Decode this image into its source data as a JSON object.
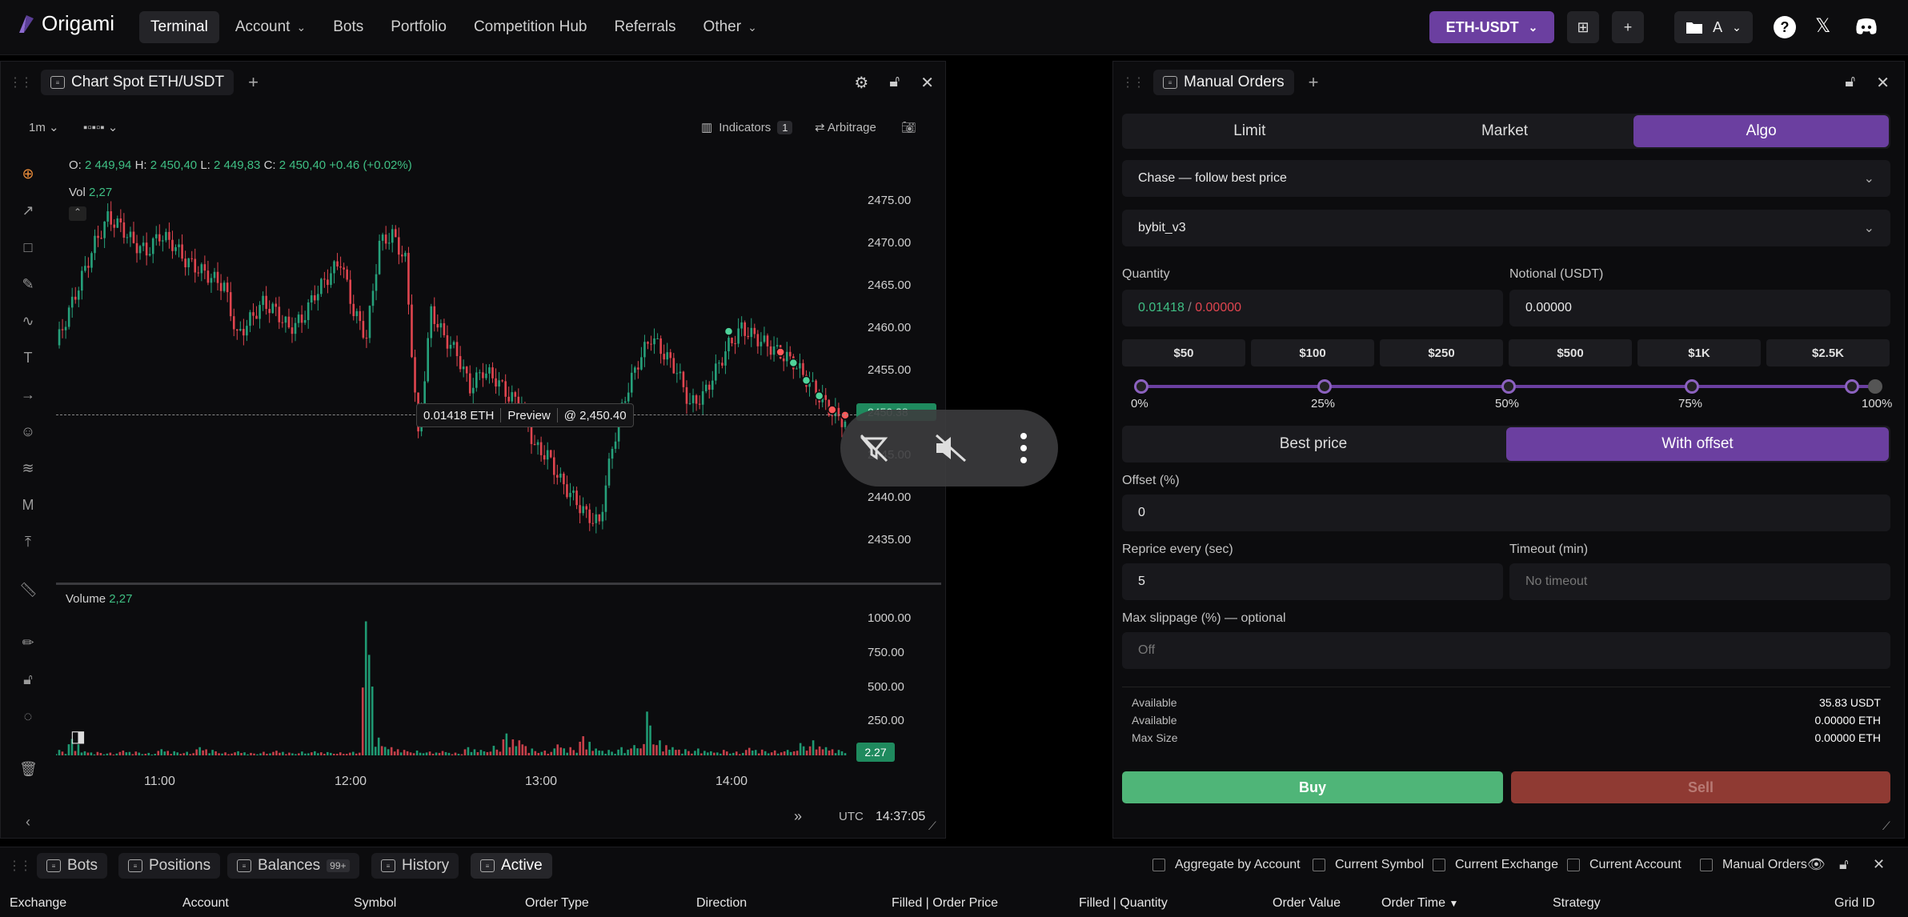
{
  "brand": {
    "name": "Origami"
  },
  "nav": [
    {
      "label": "Terminal",
      "active": true,
      "dropdown": false
    },
    {
      "label": "Account",
      "dropdown": true
    },
    {
      "label": "Bots",
      "dropdown": false
    },
    {
      "label": "Portfolio",
      "dropdown": false
    },
    {
      "label": "Competition Hub",
      "dropdown": false
    },
    {
      "label": "Referrals",
      "dropdown": false
    },
    {
      "label": "Other",
      "dropdown": true
    }
  ],
  "topbar": {
    "pair": "ETH-USDT",
    "account": "A"
  },
  "chart_panel": {
    "tab": "Chart Spot  ETH/USDT",
    "timeframe": "1m",
    "indicators_label": "Indicators",
    "indicators_count": "1",
    "arbitrage_label": "Arbitrage",
    "ohlc": {
      "o_lbl": "O:",
      "o": "2 449,94",
      "h_lbl": "H:",
      "h": "2 450,40",
      "l_lbl": "L:",
      "l": "2 449,83",
      "c_lbl": "C:",
      "c": "2 450,40",
      "chg": "+0.46",
      "chg_pct": "(+0.02%)"
    },
    "vol_label": "Vol",
    "vol_value": "2,27",
    "volume_label": "Volume",
    "volume_value": "2,27",
    "price_tag": "2450.38",
    "volume_tag": "2.27",
    "preview": {
      "qty": "0.01418 ETH",
      "mid": "Preview",
      "price": "@ 2,450.40"
    },
    "timezone": "UTC",
    "clock": "14:37:05"
  },
  "chart_data": {
    "type": "candlestick",
    "price_axis": {
      "ticks": [
        "2475.00",
        "2470.00",
        "2465.00",
        "2460.00",
        "2455.00",
        "2450.38",
        "2445.00",
        "2440.00",
        "2435.00"
      ],
      "ylim": [
        2434,
        2477
      ]
    },
    "volume_axis": {
      "ticks": [
        "1000.00",
        "750.00",
        "500.00",
        "250.00"
      ],
      "ylim": [
        0,
        1100
      ]
    },
    "x_ticks": [
      "11:00",
      "12:00",
      "13:00",
      "14:00"
    ],
    "price_path": [
      2458,
      2462,
      2466,
      2470,
      2473,
      2472,
      2470,
      2469,
      2471,
      2470,
      2468,
      2467,
      2466,
      2465,
      2459,
      2461,
      2463,
      2462,
      2460,
      2461,
      2464,
      2466,
      2468,
      2462,
      2459,
      2470,
      2471,
      2468,
      2447,
      2462,
      2459,
      2457,
      2453,
      2455,
      2454,
      2452,
      2451,
      2446,
      2445,
      2442,
      2440,
      2438,
      2437,
      2446,
      2452,
      2456,
      2459,
      2457,
      2455,
      2451,
      2452,
      2455,
      2458,
      2460,
      2459,
      2458,
      2457,
      2456,
      2454,
      2452,
      2450,
      2449
    ],
    "volume_values": [
      40,
      120,
      30,
      25,
      20,
      35,
      28,
      18,
      45,
      30,
      26,
      60,
      40,
      22,
      30,
      18,
      26,
      34,
      20,
      28,
      30,
      24,
      22,
      26,
      980,
      130,
      60,
      40,
      35,
      28,
      32,
      20,
      60,
      40,
      70,
      160,
      110,
      50,
      35,
      80,
      60,
      140,
      50,
      40,
      60,
      75,
      320,
      110,
      60,
      45,
      50,
      30,
      40,
      28,
      55,
      42,
      36,
      40,
      90,
      110,
      60,
      40
    ],
    "markers": [
      {
        "type": "buy",
        "index": 57
      },
      {
        "type": "buy",
        "index": 58
      },
      {
        "type": "buy",
        "index": 59
      },
      {
        "type": "sell",
        "index": 56
      },
      {
        "type": "sell",
        "index": 60
      },
      {
        "type": "buy",
        "index": 52
      },
      {
        "type": "buy",
        "index": 62
      },
      {
        "type": "sell",
        "index": 63
      }
    ]
  },
  "orders_panel": {
    "tab": "Manual Orders",
    "order_types": [
      "Limit",
      "Market",
      "Algo"
    ],
    "active_order_type": "Algo",
    "strategy": "Chase — follow best price",
    "exchange": "bybit_v3",
    "quantity_label": "Quantity",
    "quantity_value": "0.01418",
    "quantity_sep": " / ",
    "quantity_max": "0.00000",
    "notional_label": "Notional (USDT)",
    "notional_value": "0.00000",
    "quick_amounts": [
      "$50",
      "$100",
      "$250",
      "$500",
      "$1K",
      "$2.5K"
    ],
    "slider_value": 1.0,
    "slider_labels": [
      "0%",
      "25%",
      "50%",
      "75%",
      "100%"
    ],
    "price_modes": [
      "Best price",
      "With offset"
    ],
    "active_price_mode": "With offset",
    "offset_label": "Offset (%)",
    "offset_value": "0",
    "reprice_label": "Reprice every (sec)",
    "reprice_value": "5",
    "timeout_label": "Timeout (min)",
    "timeout_placeholder": "No timeout",
    "slippage_label": "Max slippage (%) — optional",
    "slippage_placeholder": "Off",
    "available": [
      {
        "label": "Available",
        "value": "35.83 USDT"
      },
      {
        "label": "Available",
        "value": "0.00000 ETH"
      },
      {
        "label": "Max Size",
        "value": "0.00000 ETH"
      }
    ],
    "buy_label": "Buy",
    "sell_label": "Sell"
  },
  "bottom": {
    "tabs": [
      {
        "label": "Bots"
      },
      {
        "label": "Positions"
      },
      {
        "label": "Balances",
        "badge": "99+"
      },
      {
        "label": "History"
      },
      {
        "label": "Active",
        "active": true
      }
    ],
    "filters": [
      "Aggregate by Account",
      "Current Symbol",
      "Current Exchange",
      "Current Account",
      "Manual Orders"
    ],
    "columns": [
      "Exchange",
      "Account",
      "Symbol",
      "Order Type",
      "Direction",
      "Filled | Order Price",
      "Filled | Quantity",
      "Order Value",
      "Order Time",
      "Strategy",
      "Grid ID"
    ]
  },
  "colors": {
    "accent": "#6b3fa0",
    "buy": "#4fb578",
    "sell": "#8f3a33",
    "up": "#26a17b",
    "down": "#e0454f"
  }
}
